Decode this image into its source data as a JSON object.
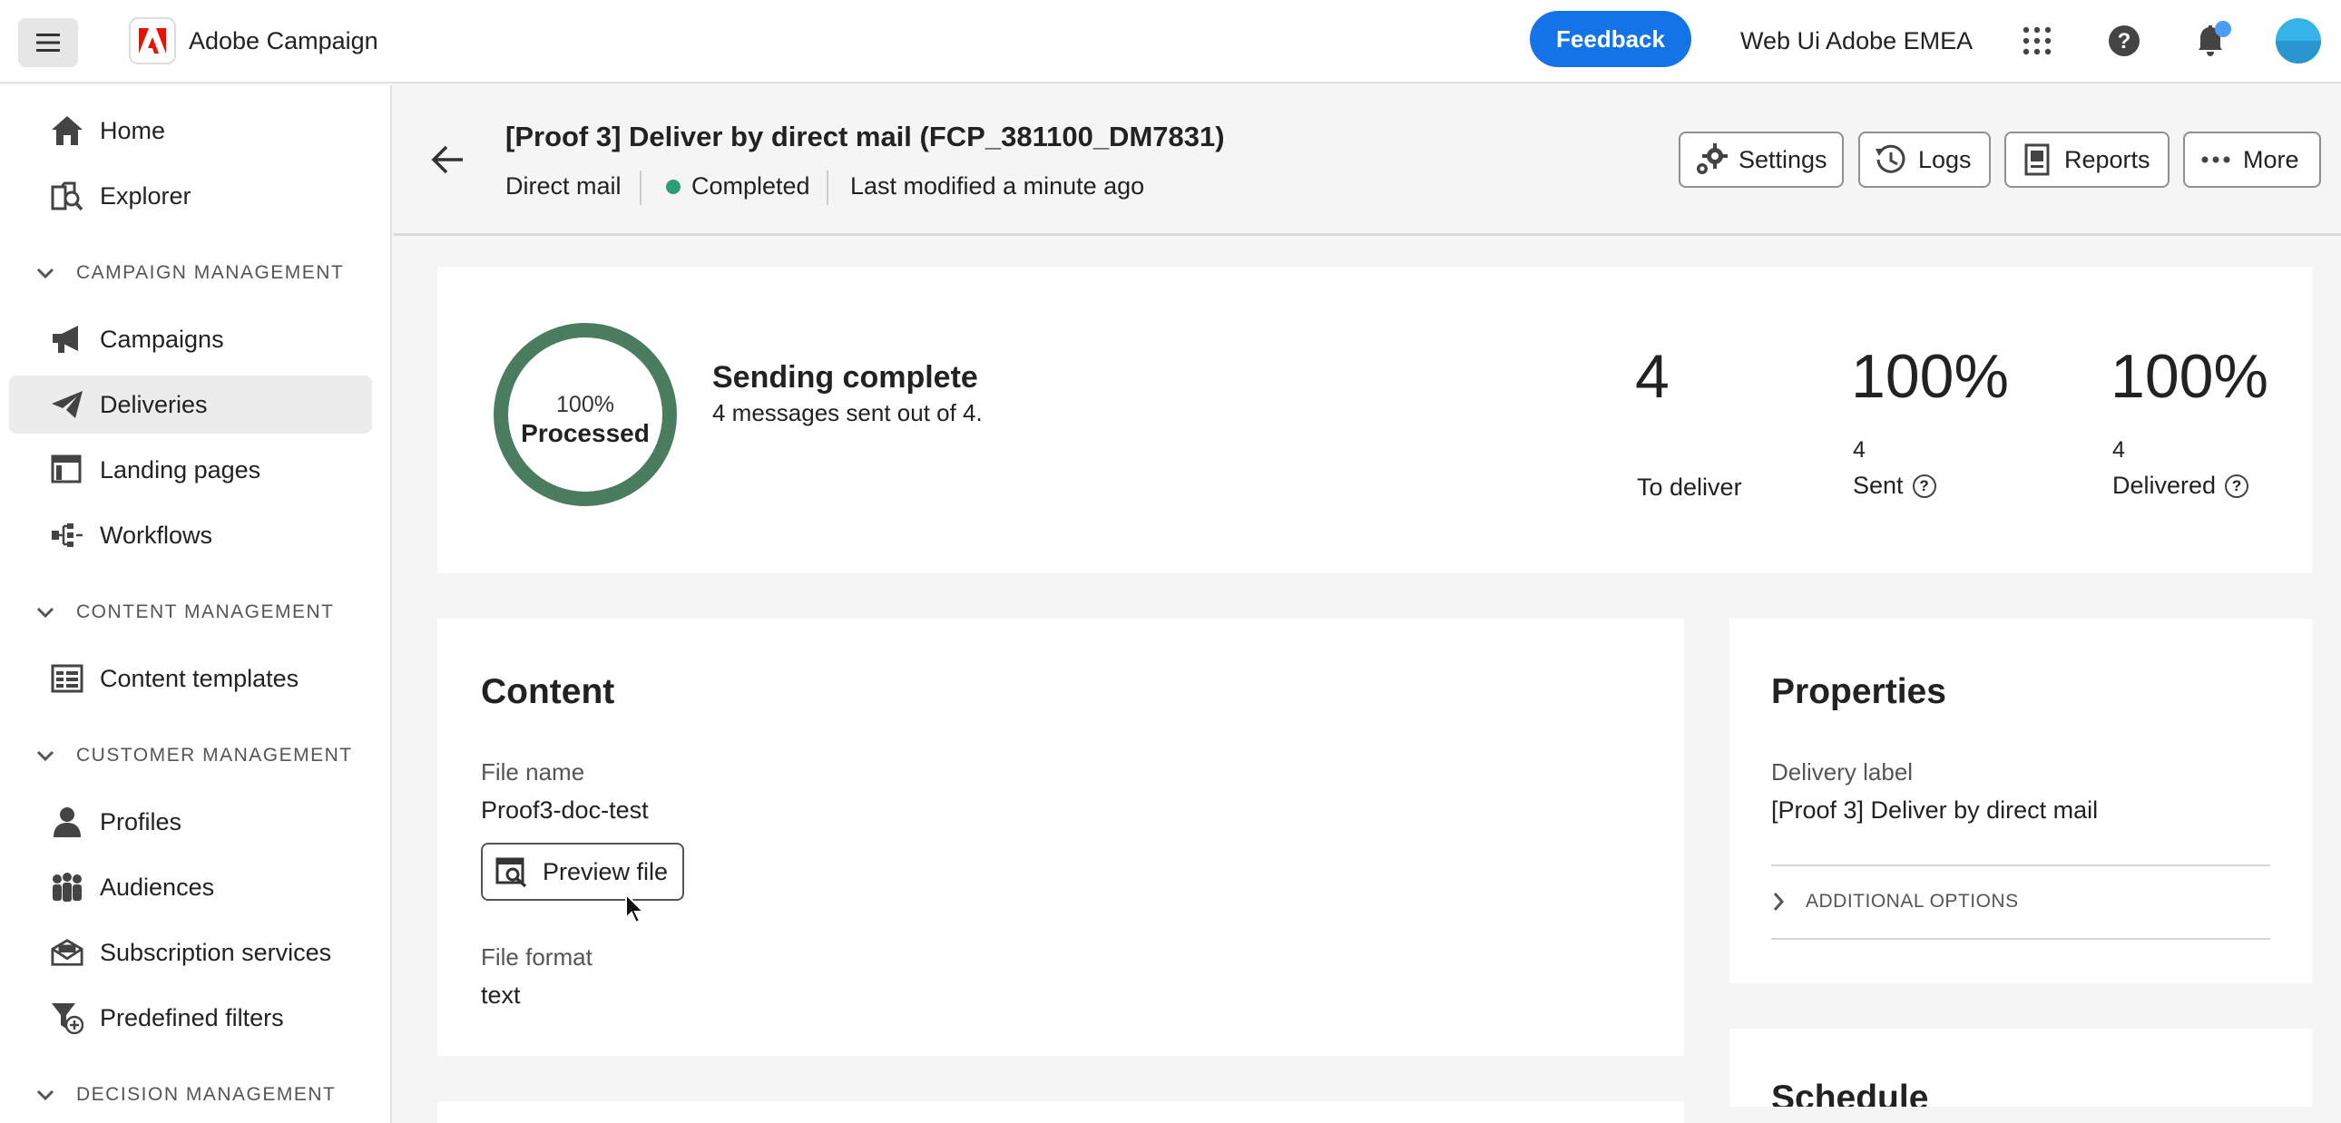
{
  "topbar": {
    "app_name": "Adobe Campaign",
    "feedback_label": "Feedback",
    "org_name": "Web Ui Adobe EMEA",
    "icons": [
      "menu-icon",
      "adobe-logo",
      "apps-grid-icon",
      "help-icon",
      "bell-icon",
      "avatar"
    ],
    "brand_color": "#1473e6"
  },
  "sidebar": {
    "items": [
      {
        "label": "Home",
        "icon": "home-icon"
      },
      {
        "label": "Explorer",
        "icon": "explorer-icon"
      },
      {
        "label": "Campaigns",
        "icon": "megaphone-icon"
      },
      {
        "label": "Deliveries",
        "icon": "paper-plane-icon",
        "active": true
      },
      {
        "label": "Landing pages",
        "icon": "landing-pages-icon"
      },
      {
        "label": "Workflows",
        "icon": "workflow-icon"
      },
      {
        "label": "Content templates",
        "icon": "templates-icon"
      },
      {
        "label": "Profiles",
        "icon": "profile-icon"
      },
      {
        "label": "Audiences",
        "icon": "audiences-icon"
      },
      {
        "label": "Subscription services",
        "icon": "subscription-icon"
      },
      {
        "label": "Predefined filters",
        "icon": "filter-icon"
      }
    ],
    "sections": [
      {
        "label": "CAMPAIGN MANAGEMENT"
      },
      {
        "label": "CONTENT MANAGEMENT"
      },
      {
        "label": "CUSTOMER MANAGEMENT"
      },
      {
        "label": "DECISION MANAGEMENT"
      }
    ]
  },
  "header": {
    "title": "[Proof 3] Deliver by direct mail (FCP_381100_DM7831)",
    "channel": "Direct mail",
    "status": "Completed",
    "status_color": "#2d9d78",
    "modified": "Last modified a minute ago",
    "buttons": {
      "settings": "Settings",
      "logs": "Logs",
      "reports": "Reports",
      "more": "More"
    }
  },
  "summary": {
    "progress_percent_label": "100%",
    "progress_value": 1.0,
    "progress_caption": "Processed",
    "progress_color": "#4a7c5f",
    "heading": "Sending complete",
    "subtext": "4 messages sent out of 4.",
    "to_deliver_value": "4",
    "to_deliver_label": "To deliver",
    "sent_percent": "100%",
    "sent_count": "4",
    "sent_label": "Sent",
    "delivered_percent": "100%",
    "delivered_count": "4",
    "delivered_label": "Delivered",
    "help_glyph": "?"
  },
  "content": {
    "title": "Content",
    "file_name_label": "File name",
    "file_name_value": "Proof3-doc-test",
    "preview_label": "Preview file",
    "file_format_label": "File format",
    "file_format_value": "text"
  },
  "properties": {
    "title": "Properties",
    "delivery_label_label": "Delivery label",
    "delivery_label_value": "[Proof 3] Deliver by direct mail",
    "additional_options": "ADDITIONAL OPTIONS"
  },
  "schedule": {
    "title": "Schedule"
  }
}
